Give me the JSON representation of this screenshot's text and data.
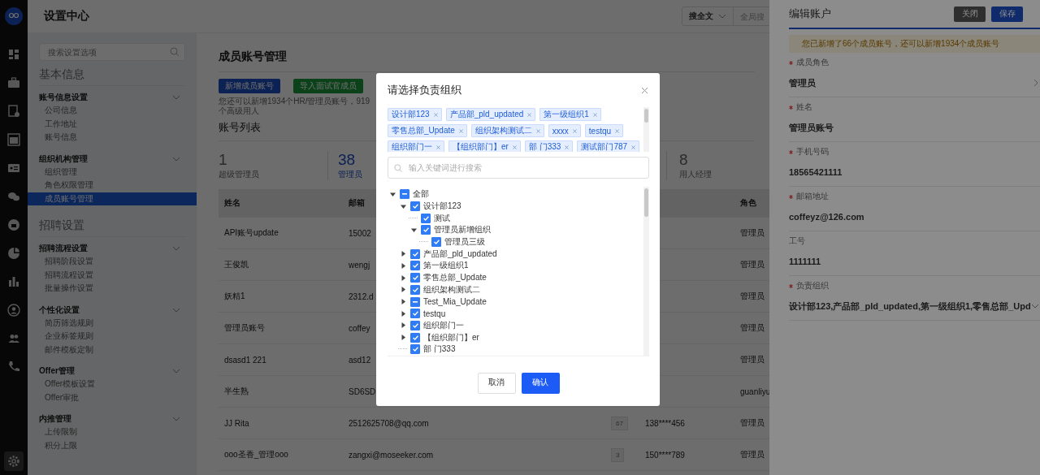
{
  "rail": {
    "items": [
      {
        "kind": "logo",
        "selected": false
      },
      {
        "kind": "grid",
        "selected": false
      },
      {
        "kind": "briefcase",
        "selected": false
      },
      {
        "kind": "report",
        "selected": false
      },
      {
        "kind": "calendar",
        "selected": false
      },
      {
        "kind": "card",
        "selected": false
      },
      {
        "kind": "chat",
        "selected": false
      },
      {
        "kind": "like",
        "selected": false
      },
      {
        "kind": "pie",
        "selected": false
      },
      {
        "kind": "bars",
        "selected": false
      },
      {
        "kind": "person",
        "selected": false
      },
      {
        "kind": "people",
        "selected": false
      },
      {
        "kind": "phone",
        "selected": false
      },
      {
        "kind": "gear",
        "selected": true
      }
    ]
  },
  "header": {
    "title": "设置中心",
    "search_scope": "搜全文",
    "search_placeholder": "全局搜"
  },
  "sidebar": {
    "search_placeholder": "搜索设置选项",
    "sections": [
      {
        "title": "基本信息",
        "groups": [
          {
            "title": "账号信息设置",
            "expanded": true,
            "items": [
              {
                "label": "公司信息",
                "selected": false
              },
              {
                "label": "工作地址",
                "selected": false
              },
              {
                "label": "账号信息",
                "selected": false
              }
            ]
          },
          {
            "title": "组织机构管理",
            "expanded": true,
            "items": [
              {
                "label": "组织管理",
                "selected": false
              },
              {
                "label": "角色权限管理",
                "selected": false
              },
              {
                "label": "成员账号管理",
                "selected": true
              }
            ]
          }
        ]
      },
      {
        "title": "招聘设置",
        "groups": [
          {
            "title": "招聘流程设置",
            "expanded": true,
            "items": [
              {
                "label": "招聘阶段设置",
                "selected": false
              },
              {
                "label": "招聘流程设置",
                "selected": false
              },
              {
                "label": "批量操作设置",
                "selected": false
              }
            ]
          },
          {
            "title": "个性化设置",
            "expanded": true,
            "items": [
              {
                "label": "简历筛选规则",
                "selected": false
              },
              {
                "label": "企业标签规则",
                "selected": false
              },
              {
                "label": "邮件模板定制",
                "selected": false
              }
            ]
          },
          {
            "title": "Offer管理",
            "expanded": true,
            "items": [
              {
                "label": "Offer模板设置",
                "selected": false
              },
              {
                "label": "Offer审批",
                "selected": false
              }
            ]
          },
          {
            "title": "内推管理",
            "expanded": true,
            "items": [
              {
                "label": "上传限制",
                "selected": false
              },
              {
                "label": "积分上限",
                "selected": false
              }
            ]
          }
        ]
      }
    ]
  },
  "main": {
    "title": "成员账号管理",
    "buttons": [
      {
        "label": "新增成员账号",
        "kind": "primary"
      },
      {
        "label": "导入面试官成员",
        "kind": "success"
      }
    ],
    "note": "您还可以新增1934个HR/管理员账号，919个高级用人",
    "list_title": "账号列表",
    "stats": [
      {
        "value": "1",
        "label": "超级管理员",
        "selected": false
      },
      {
        "value": "38",
        "label": "管理员",
        "selected": true
      },
      {
        "value": "8",
        "label": "用人经理",
        "selected": false
      }
    ],
    "table": {
      "columns": [
        "姓名",
        "邮箱",
        "",
        "",
        "角色"
      ],
      "rows": [
        {
          "name": "API账号update",
          "email": "15002",
          "role": "管理员"
        },
        {
          "name": "王俊凯",
          "email": "wengj",
          "role": "管理员"
        },
        {
          "name": "妖精1",
          "email": "2312.d",
          "role": "管理员"
        },
        {
          "name": "管理员账号",
          "email": "coffey",
          "role": "管理员"
        },
        {
          "name": "dsasd1 221",
          "email": "asd12",
          "role": "管理员"
        },
        {
          "name": "半生熟",
          "email": "SD6SD",
          "role": "guanliyu"
        },
        {
          "name": "JJ Rita",
          "email": "2512625708@qq.com",
          "column_4": "67",
          "column_3": "138****456",
          "role": "管理员"
        },
        {
          "name": "ooo圣香_管理ooo",
          "email": "zangxi@moseeker.com",
          "column_4": "3",
          "column_3": "150****789",
          "role": "管理员"
        }
      ]
    }
  },
  "drawer": {
    "title": "编辑账户",
    "buttons": [
      {
        "label": "关闭",
        "kind": "secondary"
      },
      {
        "label": "保存",
        "kind": "primary"
      }
    ],
    "alert": "您已新增了66个成员账号，还可以新增1934个成员账号",
    "fields": [
      {
        "label": "成员角色",
        "value": "管理员",
        "required": true,
        "kind": "select"
      },
      {
        "label": "姓名",
        "value": "管理员账号",
        "required": true,
        "kind": "text"
      },
      {
        "label": "手机号码",
        "value": "18565421111",
        "required": true,
        "kind": "text"
      },
      {
        "label": "邮箱地址",
        "value": "coffeyz@126.com",
        "required": true,
        "kind": "text"
      },
      {
        "label": "工号",
        "value": "1111111",
        "required": false,
        "kind": "text"
      },
      {
        "label": "负责组织",
        "value": "设计部123,产品部_pld_updated,第一级组织1,零售总部_Upd",
        "required": true,
        "kind": "dropdown"
      }
    ]
  },
  "modal": {
    "title": "请选择负责组织",
    "tags": [
      "设计部123",
      "产品部_pld_updated",
      "第一级组织1",
      "零售总部_Update",
      "组织架构测试二",
      "xxxx",
      "testqu",
      "组织部门一",
      "【组织部门】er",
      "部 门333",
      "测试部门787"
    ],
    "search_placeholder": "输入关键词进行搜索",
    "tree": [
      {
        "label": "全部",
        "expanded": true,
        "checked": false,
        "indeterminate": true,
        "children": [
          {
            "label": "设计部123",
            "expanded": true,
            "checked": true,
            "indeterminate": false,
            "children": [
              {
                "label": "测试",
                "checked": true,
                "indeterminate": false
              },
              {
                "label": "管理员新增组织",
                "expanded": true,
                "checked": true,
                "indeterminate": false,
                "children": [
                  {
                    "label": "管理员三级",
                    "checked": true,
                    "indeterminate": false
                  }
                ]
              }
            ]
          },
          {
            "label": "产品部_pld_updated",
            "expanded": false,
            "checked": true,
            "indeterminate": false
          },
          {
            "label": "第一级组织1",
            "expanded": false,
            "checked": true,
            "indeterminate": false
          },
          {
            "label": "零售总部_Update",
            "expanded": false,
            "checked": true,
            "indeterminate": false
          },
          {
            "label": "组织架构测试二",
            "expanded": false,
            "checked": true,
            "indeterminate": false
          },
          {
            "label": "Test_Mia_Update",
            "expanded": false,
            "checked": false,
            "indeterminate": true
          },
          {
            "label": "testqu",
            "expanded": false,
            "checked": true,
            "indeterminate": false
          },
          {
            "label": "组织部门一",
            "expanded": false,
            "checked": true,
            "indeterminate": false
          },
          {
            "label": "【组织部门】er",
            "expanded": false,
            "checked": true,
            "indeterminate": false
          },
          {
            "label": "部 门333",
            "checked": true,
            "indeterminate": false
          }
        ]
      }
    ],
    "buttons": [
      {
        "label": "取消",
        "kind": "secondary"
      },
      {
        "label": "确认",
        "kind": "primary"
      }
    ]
  }
}
